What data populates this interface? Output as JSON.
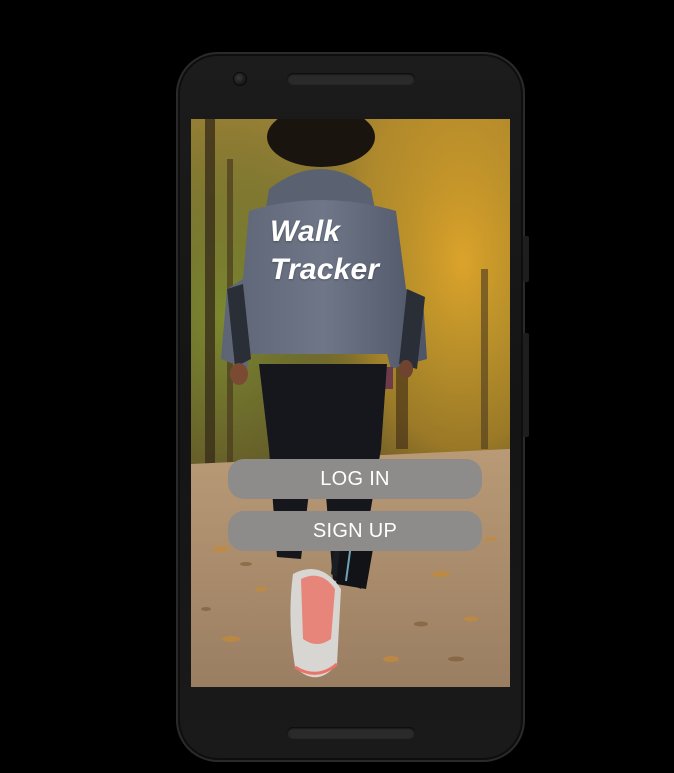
{
  "app": {
    "title_line1": "Walk",
    "title_line2": "Tracker"
  },
  "buttons": {
    "login_label": "LOG IN",
    "signup_label": "SIGN UP"
  },
  "background": {
    "icon": "jogger-autumn-park-photo"
  },
  "colors": {
    "button_bg": "#8e8b8b",
    "button_text": "#ffffff",
    "title_text": "#ffffff",
    "device_frame": "#161616",
    "page_bg": "#000000"
  }
}
